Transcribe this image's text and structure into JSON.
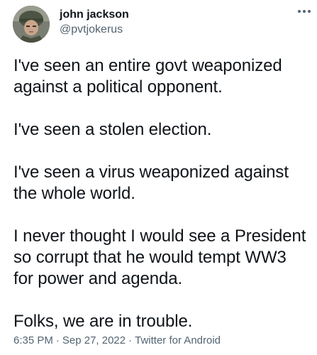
{
  "author": {
    "display_name": "john jackson",
    "handle": "@pvtjokerus",
    "avatar_icon": "soldier-helmet-avatar"
  },
  "more_icon": "ellipsis-icon",
  "tweet": {
    "paragraphs": [
      "I've seen an entire govt weaponized\nagainst a political opponent.",
      "I've seen a stolen election.",
      "I've seen a virus weaponized against\nthe whole world.",
      "I never thought I would see a President\nso corrupt that he would tempt WW3\nfor power and agenda.",
      "Folks, we are in trouble."
    ]
  },
  "meta": {
    "time": "6:35 PM",
    "separator": "·",
    "date": "Sep 27, 2022",
    "source": "Twitter for Android"
  },
  "colors": {
    "text": "#0f1419",
    "secondary": "#536471",
    "background": "#ffffff"
  }
}
